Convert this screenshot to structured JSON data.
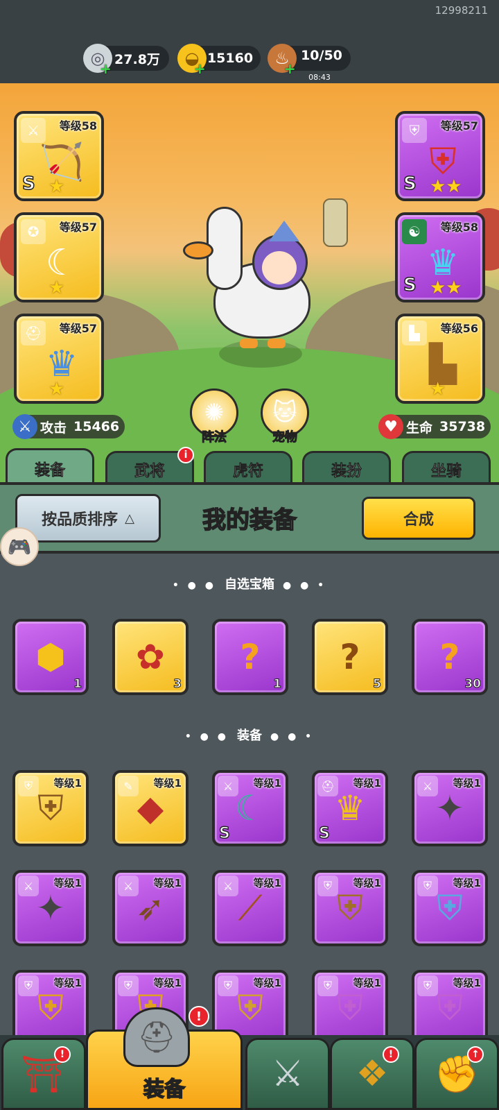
{
  "header": {
    "uid": "12998211",
    "resources": [
      {
        "icon": "coin-icon",
        "value": "27.8万",
        "sub": ""
      },
      {
        "icon": "gold-ingot-icon",
        "value": "15160",
        "sub": ""
      },
      {
        "icon": "drumstick-icon",
        "value": "10/50",
        "sub": "08:43"
      }
    ]
  },
  "hero": {
    "left_slots": [
      {
        "level": "等级58",
        "rarity": "gold",
        "grade": "S",
        "stars": "★",
        "icon": "crossbow-icon"
      },
      {
        "level": "等级57",
        "rarity": "gold",
        "grade": "",
        "stars": "★",
        "icon": "amulet-icon"
      },
      {
        "level": "等级57",
        "rarity": "gold",
        "grade": "",
        "stars": "★",
        "icon": "helmet-icon"
      }
    ],
    "right_slots": [
      {
        "level": "等级57",
        "rarity": "purple",
        "grade": "S",
        "stars": "★★",
        "icon": "armor-icon"
      },
      {
        "level": "等级58",
        "rarity": "purple",
        "grade": "S",
        "stars": "★★",
        "icon": "helmet-icon"
      },
      {
        "level": "等级56",
        "rarity": "gold",
        "grade": "",
        "stars": "★",
        "icon": "boots-icon"
      }
    ],
    "attack_label": "攻击",
    "attack_value": "15466",
    "hp_label": "生命",
    "hp_value": "35738",
    "formation_label": "阵法",
    "pet_label": "宠物"
  },
  "tabs": [
    {
      "label": "装备",
      "active": true,
      "badge": ""
    },
    {
      "label": "武将",
      "active": false,
      "badge": "i"
    },
    {
      "label": "虎符",
      "active": false,
      "badge": ""
    },
    {
      "label": "装扮",
      "active": false,
      "badge": ""
    },
    {
      "label": "坐骑",
      "active": false,
      "badge": ""
    }
  ],
  "panel": {
    "sort_label": "按品质排序",
    "title": "我的装备",
    "synth_label": "合成"
  },
  "chest_section": {
    "title": "自选宝箱",
    "items": [
      {
        "rarity": "purple",
        "count": "1",
        "icon": "chest-icon"
      },
      {
        "rarity": "gold",
        "count": "3",
        "icon": "chest-icon"
      },
      {
        "rarity": "purple",
        "count": "1",
        "icon": "mystery-chest-icon"
      },
      {
        "rarity": "gold",
        "count": "5",
        "icon": "mystery-chest-icon"
      },
      {
        "rarity": "purple",
        "count": "30",
        "icon": "mystery-chest-icon"
      }
    ]
  },
  "equip_section": {
    "title": "装备",
    "items": [
      {
        "rarity": "gold",
        "level": "等级1",
        "grade": "",
        "icon": "armor-icon"
      },
      {
        "rarity": "gold",
        "level": "等级1",
        "grade": "",
        "icon": "bracer-icon"
      },
      {
        "rarity": "purple",
        "level": "等级1",
        "grade": "S",
        "icon": "blade-icon"
      },
      {
        "rarity": "purple",
        "level": "等级1",
        "grade": "S",
        "icon": "helmet-icon"
      },
      {
        "rarity": "purple",
        "level": "等级1",
        "grade": "",
        "icon": "shuriken-icon"
      },
      {
        "rarity": "purple",
        "level": "等级1",
        "grade": "",
        "icon": "shuriken-icon"
      },
      {
        "rarity": "purple",
        "level": "等级1",
        "grade": "",
        "icon": "bow-icon"
      },
      {
        "rarity": "purple",
        "level": "等级1",
        "grade": "",
        "icon": "club-icon"
      },
      {
        "rarity": "purple",
        "level": "等级1",
        "grade": "",
        "icon": "armor-icon"
      },
      {
        "rarity": "purple",
        "level": "等级1",
        "grade": "",
        "icon": "armor-icon"
      },
      {
        "rarity": "purple",
        "level": "等级1",
        "grade": "",
        "icon": "armor-icon"
      },
      {
        "rarity": "purple",
        "level": "等级1",
        "grade": "",
        "icon": "armor-icon"
      },
      {
        "rarity": "purple",
        "level": "等级1",
        "grade": "",
        "icon": "armor-icon"
      },
      {
        "rarity": "purple",
        "level": "等级1",
        "grade": "",
        "icon": "armor-icon"
      },
      {
        "rarity": "purple",
        "level": "等级1",
        "grade": "",
        "icon": "armor-icon"
      }
    ]
  },
  "bottom_nav": [
    {
      "icon": "shop-icon",
      "label": "",
      "badge": "!"
    },
    {
      "icon": "helmet-icon",
      "label": "装备",
      "badge": "!",
      "active": true
    },
    {
      "icon": "battle-icon",
      "label": "",
      "badge": ""
    },
    {
      "icon": "upgrade-icon",
      "label": "",
      "badge": "!"
    },
    {
      "icon": "fist-icon",
      "label": "",
      "badge": "↑"
    }
  ]
}
